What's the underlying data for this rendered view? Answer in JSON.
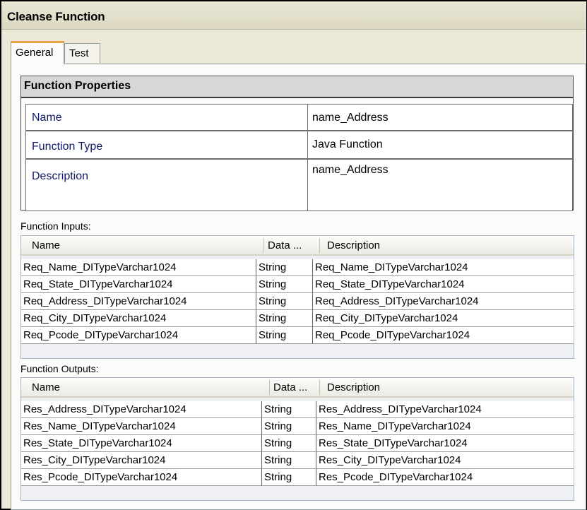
{
  "window": {
    "title": "Cleanse Function"
  },
  "tabs": [
    {
      "label": "General",
      "active": true
    },
    {
      "label": "Test",
      "active": false
    }
  ],
  "properties": {
    "header": "Function Properties",
    "rows": [
      {
        "label": "Name",
        "value": "name_Address"
      },
      {
        "label": "Function Type",
        "value": "Java Function"
      },
      {
        "label": "Description",
        "value": "name_Address"
      }
    ]
  },
  "inputs": {
    "label": "Function Inputs:",
    "columns": [
      "Name",
      "Data ...",
      "Description"
    ],
    "rows": [
      [
        "Req_Name_DITypeVarchar1024",
        "String",
        "Req_Name_DITypeVarchar1024"
      ],
      [
        "Req_State_DITypeVarchar1024",
        "String",
        "Req_State_DITypeVarchar1024"
      ],
      [
        "Req_Address_DITypeVarchar1024",
        "String",
        "Req_Address_DITypeVarchar1024"
      ],
      [
        "Req_City_DITypeVarchar1024",
        "String",
        "Req_City_DITypeVarchar1024"
      ],
      [
        "Req_Pcode_DITypeVarchar1024",
        "String",
        "Req_Pcode_DITypeVarchar1024"
      ]
    ]
  },
  "outputs": {
    "label": "Function Outputs:",
    "columns": [
      "Name",
      "Data ...",
      "Description"
    ],
    "rows": [
      [
        "Res_Address_DITypeVarchar1024",
        "String",
        "Res_Address_DITypeVarchar1024"
      ],
      [
        "Res_Name_DITypeVarchar1024",
        "String",
        "Res_Name_DITypeVarchar1024"
      ],
      [
        "Res_State_DITypeVarchar1024",
        "String",
        "Res_State_DITypeVarchar1024"
      ],
      [
        "Res_City_DITypeVarchar1024",
        "String",
        "Res_City_DITypeVarchar1024"
      ],
      [
        "Res_Pcode_DITypeVarchar1024",
        "String",
        "Res_Pcode_DITypeVarchar1024"
      ]
    ]
  },
  "colors": {
    "tab_accent": "#e7a64a",
    "label_text": "#101a66",
    "window_bg": "#ece9d8"
  }
}
